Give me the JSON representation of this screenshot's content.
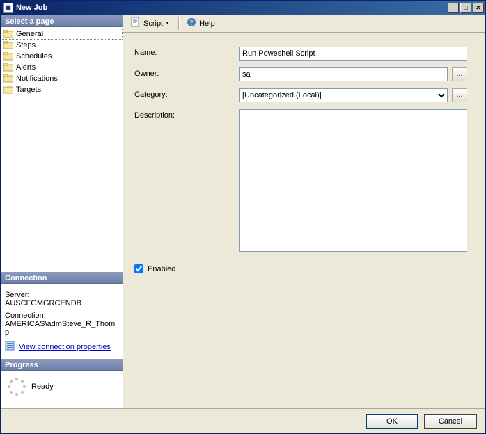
{
  "window": {
    "title": "New Job"
  },
  "toolbar": {
    "script_label": "Script",
    "help_label": "Help"
  },
  "sidebar": {
    "select_page_header": "Select a page",
    "items": [
      {
        "label": "General",
        "selected": true
      },
      {
        "label": "Steps",
        "selected": false
      },
      {
        "label": "Schedules",
        "selected": false
      },
      {
        "label": "Alerts",
        "selected": false
      },
      {
        "label": "Notifications",
        "selected": false
      },
      {
        "label": "Targets",
        "selected": false
      }
    ],
    "connection_header": "Connection",
    "server_label": "Server:",
    "server_value": "AUSCFGMGRCENDB",
    "connection_label": "Connection:",
    "connection_value": "AMERICAS\\admSteve_R_Thomp",
    "view_props_link": "View connection properties",
    "progress_header": "Progress",
    "progress_status": "Ready"
  },
  "form": {
    "name_label": "Name:",
    "name_value": "Run Poweshell Script",
    "owner_label": "Owner:",
    "owner_value": "sa",
    "owner_ellipsis": "...",
    "category_label": "Category:",
    "category_value": "[Uncategorized (Local)]",
    "category_ellipsis": "...",
    "description_label": "Description:",
    "description_value": "",
    "enabled_label": "Enabled",
    "enabled_checked": true
  },
  "footer": {
    "ok_label": "OK",
    "cancel_label": "Cancel"
  }
}
